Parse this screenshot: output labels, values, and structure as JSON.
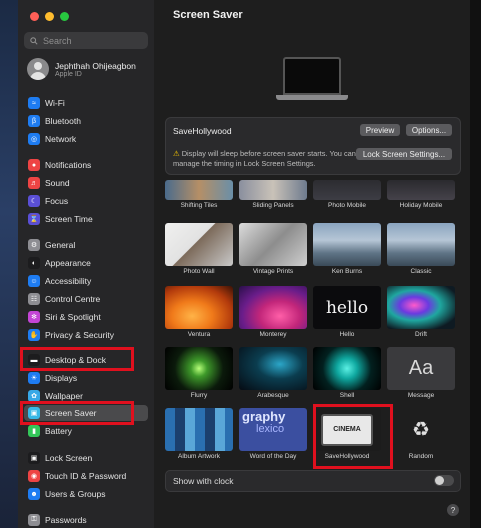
{
  "window": {
    "title": "Screen Saver"
  },
  "search": {
    "placeholder": "Search"
  },
  "account": {
    "name": "Jephthah Ohijeagbon",
    "subtitle": "Apple ID"
  },
  "sidebar": {
    "items": [
      {
        "label": "Wi-Fi",
        "icon": "wifi-icon",
        "color": "#1e7cf2"
      },
      {
        "label": "Bluetooth",
        "icon": "bluetooth-icon",
        "color": "#1e7cf2"
      },
      {
        "label": "Network",
        "icon": "globe-icon",
        "color": "#1e7cf2"
      },
      {
        "label": "Notifications",
        "icon": "bell-icon",
        "color": "#ee4444"
      },
      {
        "label": "Sound",
        "icon": "speaker-icon",
        "color": "#ee4444"
      },
      {
        "label": "Focus",
        "icon": "moon-icon",
        "color": "#5a4fd6"
      },
      {
        "label": "Screen Time",
        "icon": "hourglass-icon",
        "color": "#5a4fd6"
      },
      {
        "label": "General",
        "icon": "gear-icon",
        "color": "#8e8e93"
      },
      {
        "label": "Appearance",
        "icon": "appearance-icon",
        "color": "#1c1c1e"
      },
      {
        "label": "Accessibility",
        "icon": "accessibility-icon",
        "color": "#1e7cf2"
      },
      {
        "label": "Control Centre",
        "icon": "control-centre-icon",
        "color": "#8e8e93"
      },
      {
        "label": "Siri & Spotlight",
        "icon": "siri-icon",
        "color": "#c445d6"
      },
      {
        "label": "Privacy & Security",
        "icon": "hand-icon",
        "color": "#1e7cf2"
      },
      {
        "label": "Desktop & Dock",
        "icon": "dock-icon",
        "color": "#1c1c1e"
      },
      {
        "label": "Displays",
        "icon": "display-icon",
        "color": "#1e7cf2"
      },
      {
        "label": "Wallpaper",
        "icon": "wallpaper-icon",
        "color": "#37a8e6"
      },
      {
        "label": "Screen Saver",
        "icon": "screen-saver-icon",
        "color": "#37b8e6"
      },
      {
        "label": "Battery",
        "icon": "battery-icon",
        "color": "#34c759"
      },
      {
        "label": "Lock Screen",
        "icon": "lock-icon",
        "color": "#1c1c1e"
      },
      {
        "label": "Touch ID & Password",
        "icon": "fingerprint-icon",
        "color": "#ee4444"
      },
      {
        "label": "Users & Groups",
        "icon": "users-icon",
        "color": "#1e7cf2"
      },
      {
        "label": "Passwords",
        "icon": "key-icon",
        "color": "#8e8e93"
      }
    ],
    "selected": "Screen Saver"
  },
  "current": {
    "name": "SaveHollywood",
    "preview_button": "Preview",
    "options_button": "Options...",
    "warning": "Display will sleep before screen saver starts. You can manage the timing in Lock Screen Settings.",
    "lock_screen_button": "Lock Screen Settings..."
  },
  "savers": [
    {
      "label": "Shifting Tiles"
    },
    {
      "label": "Sliding Panels"
    },
    {
      "label": "Photo Mobile"
    },
    {
      "label": "Holiday Mobile"
    },
    {
      "label": "Photo Wall"
    },
    {
      "label": "Vintage Prints"
    },
    {
      "label": "Ken Burns"
    },
    {
      "label": "Classic"
    },
    {
      "label": "Ventura"
    },
    {
      "label": "Monterey"
    },
    {
      "label": "Hello",
      "thumb_text": "hello"
    },
    {
      "label": "Drift"
    },
    {
      "label": "Flurry"
    },
    {
      "label": "Arabesque"
    },
    {
      "label": "Shell"
    },
    {
      "label": "Message",
      "thumb_text": "Aa"
    },
    {
      "label": "Album Artwork"
    },
    {
      "label": "Word of the Day",
      "thumb_text": "graphy",
      "thumb_text2": "lexico"
    },
    {
      "label": "SaveHollywood",
      "thumb_text": "CINEMA"
    },
    {
      "label": "Random"
    }
  ],
  "show_with_clock": {
    "label": "Show with clock",
    "enabled": false
  },
  "help": "?",
  "highlight_color": "#e0101e"
}
